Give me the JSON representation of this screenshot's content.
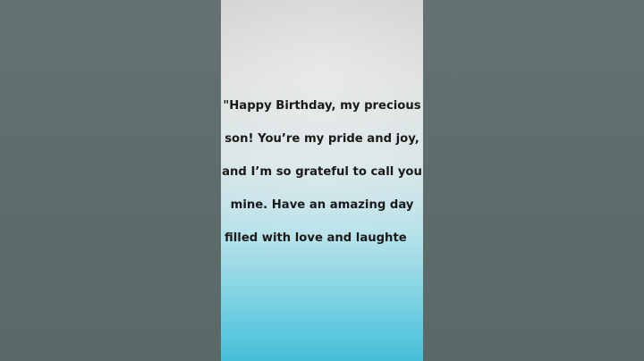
{
  "quote": {
    "lines": [
      "\"Happy Birthday, my precious",
      "son! You’re my pride and joy,",
      "and I’m so grateful to call you",
      "mine. Have an amazing day",
      "filled with love and laughte"
    ]
  },
  "colors": {
    "sides": "#5f6d6d",
    "card_top": "#cfcfcd",
    "card_bottom": "#45bfd9",
    "text": "#1a1a1a"
  }
}
